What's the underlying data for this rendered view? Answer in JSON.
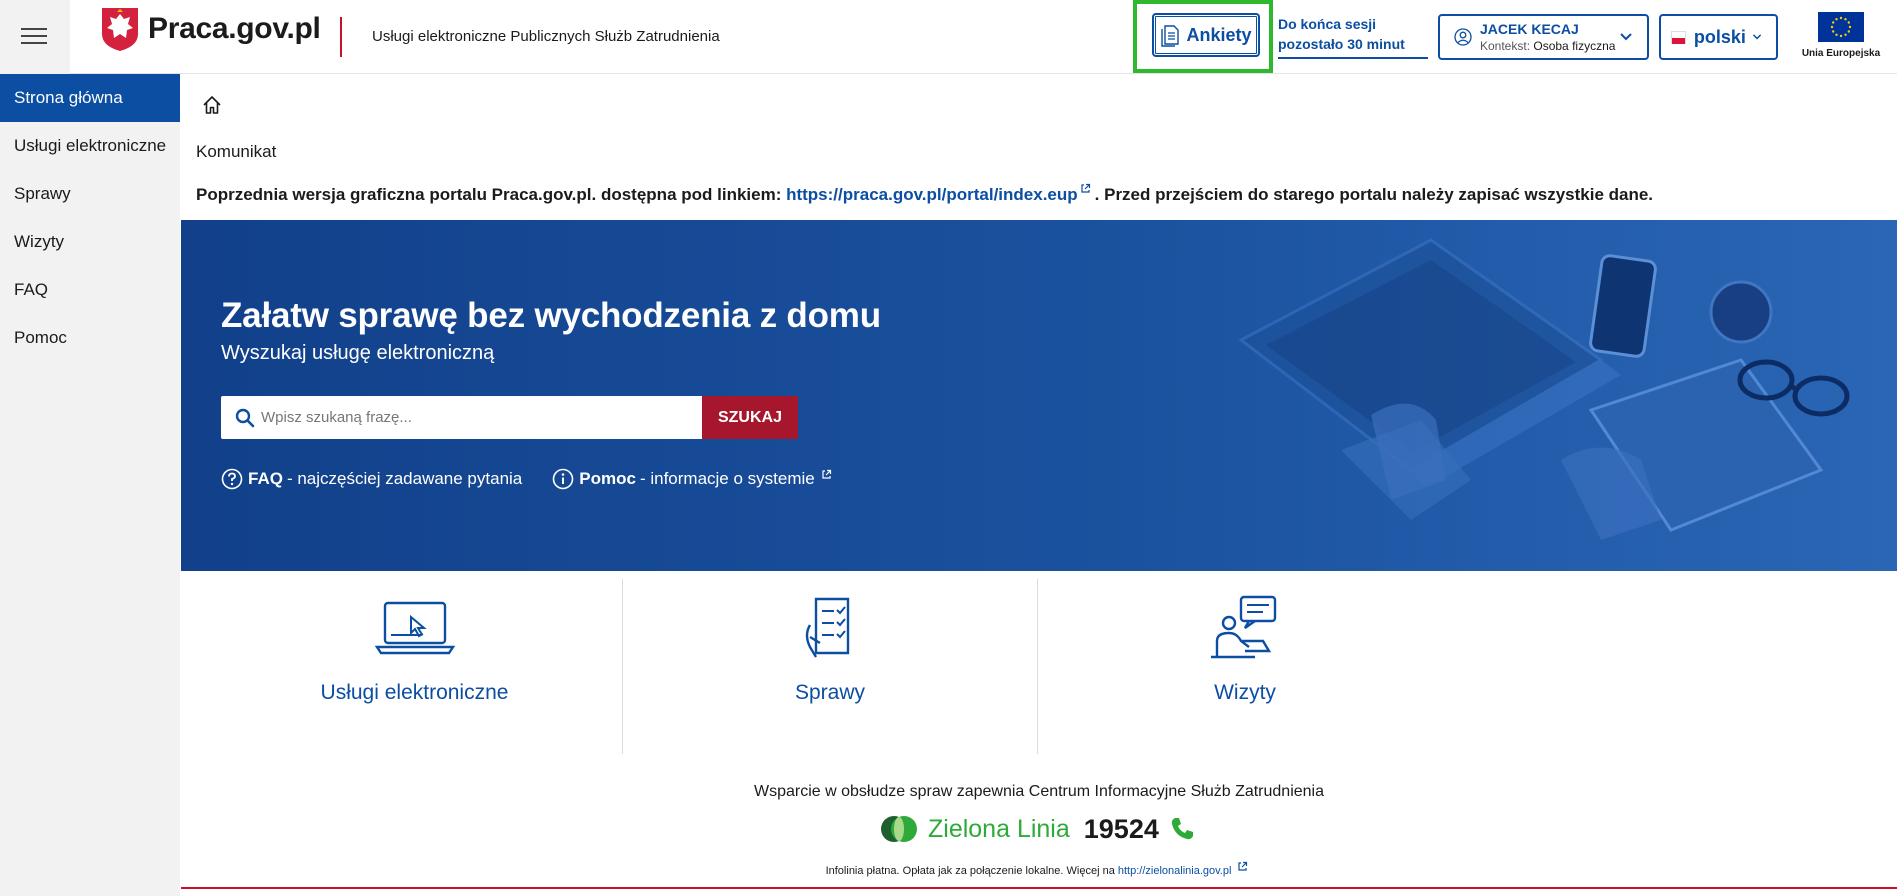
{
  "header": {
    "logo_text": "Praca.gov.pl",
    "subtitle": "Usługi elektroniczne Publicznych Służb Zatrudnienia",
    "ankiety_label": "Ankiety",
    "session_line1": "Do końca sesji",
    "session_line2": "pozostało 30 minut",
    "user_name": "JACEK KECAJ",
    "user_context_label": "Kontekst:",
    "user_context_value": "Osoba fizyczna",
    "language": "polski",
    "eu_label": "Unia Europejska"
  },
  "sidebar": {
    "items": [
      {
        "label": "Strona główna"
      },
      {
        "label": "Usługi elektroniczne"
      },
      {
        "label": "Sprawy"
      },
      {
        "label": "Wizyty"
      },
      {
        "label": "FAQ"
      },
      {
        "label": "Pomoc"
      }
    ]
  },
  "notice": {
    "title": "Komunikat",
    "text_before": "Poprzednia wersja graficzna portalu Praca.gov.pl. dostępna pod linkiem: ",
    "link_text": "https://praca.gov.pl/portal/index.eup",
    "text_after": ". Przed przejściem do starego portalu należy zapisać wszystkie dane."
  },
  "hero": {
    "title": "Załatw sprawę bez wychodzenia z domu",
    "subtitle": "Wyszukaj usługę elektroniczną",
    "search_placeholder": "Wpisz szukaną frazę...",
    "search_button": "SZUKAJ",
    "faq_bold": "FAQ",
    "faq_text": "- najczęściej zadawane pytania",
    "help_bold": "Pomoc",
    "help_text": "- informacje o systemie"
  },
  "tiles": [
    {
      "label": "Usługi elektroniczne"
    },
    {
      "label": "Sprawy"
    },
    {
      "label": "Wizyty"
    }
  ],
  "footer": {
    "support_text": "Wsparcie w obsłudze spraw zapewnia Centrum Informacyjne Służb Zatrudnienia",
    "zielona_linia": "Zielona Linia",
    "phone_number": "19524",
    "info_text": "Infolinia płatna. Opłata jak za połączenie lokalne. Więcej na ",
    "info_link": "http://zielonalinia.gov.pl"
  },
  "colors": {
    "brand_blue": "#0b4ea2",
    "hero_blue": "#1a4f9c",
    "search_red": "#a6172d",
    "highlight_green": "#2eb82e",
    "zielona_green": "#2eaa3a"
  }
}
